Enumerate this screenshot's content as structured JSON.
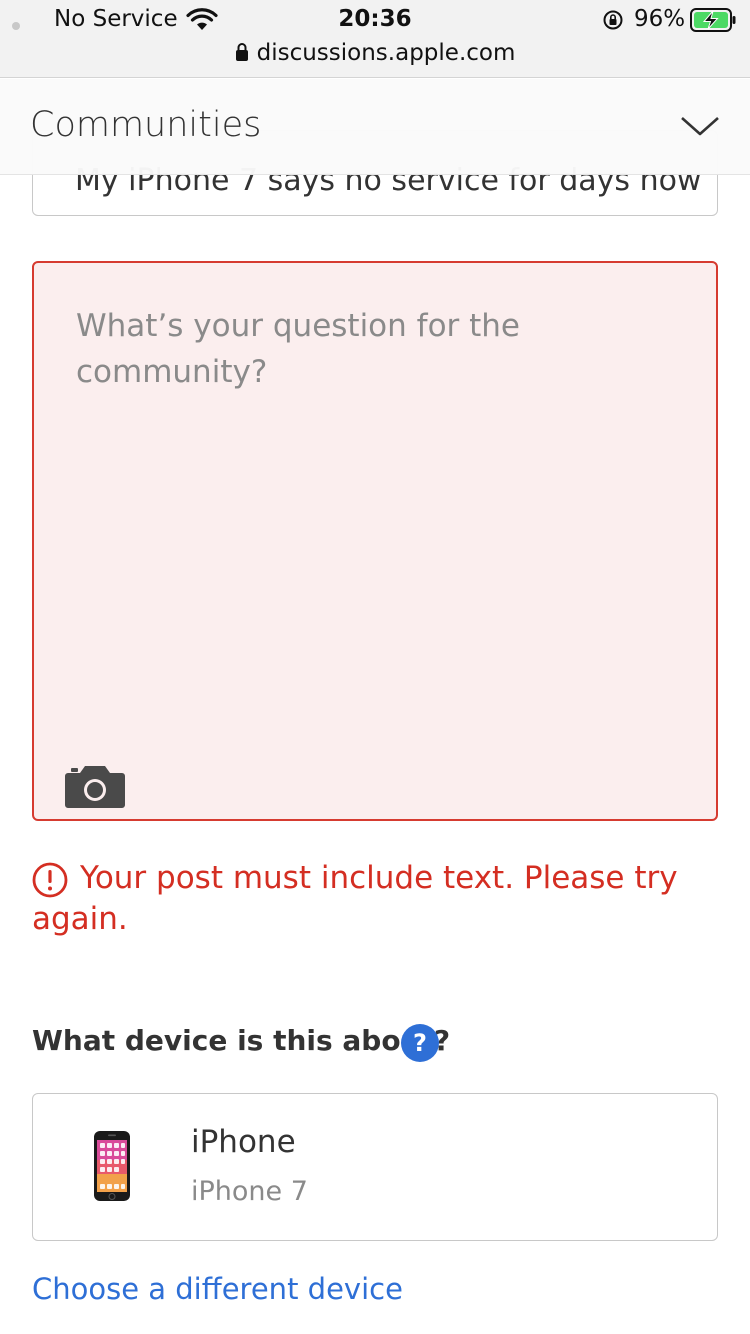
{
  "status_bar": {
    "carrier": "No Service",
    "time": "20:36",
    "battery_percent": "96%",
    "url": "discussions.apple.com",
    "icons": [
      "wifi-icon",
      "orientation-lock-icon",
      "battery-charging-icon",
      "lock-icon"
    ]
  },
  "header": {
    "title": "Communities",
    "menu_icon": "chevron-down-icon"
  },
  "form": {
    "title_value": "My iPhone 7 says no service for days now",
    "question_placeholder": "What’s your question for the community?",
    "attach_icon": "camera-icon",
    "error_message": "Your post must include text. Please try again.",
    "device_question": "What device is this about?",
    "help_label": "?",
    "device": {
      "name": "iPhone",
      "model": "iPhone 7",
      "icon": "iphone-icon"
    },
    "choose_device_link": "Choose a different device"
  },
  "colors": {
    "error": "#d42e22",
    "error_background": "#fbeeee",
    "link": "#2e6fd6",
    "battery_fill": "#4cd964"
  }
}
